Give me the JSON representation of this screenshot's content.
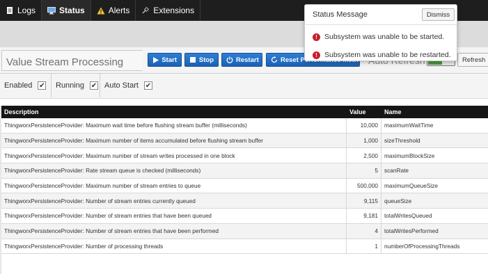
{
  "nav": {
    "tabs": [
      {
        "label": "Logs",
        "icon": "document-icon"
      },
      {
        "label": "Status",
        "icon": "monitor-icon",
        "active": true
      },
      {
        "label": "Alerts",
        "icon": "warning-icon"
      },
      {
        "label": "Extensions",
        "icon": "plug-icon"
      }
    ]
  },
  "panel": {
    "title": "Value Stream Processing",
    "buttons": {
      "start": "Start",
      "stop": "Stop",
      "restart": "Restart",
      "reset": "Reset Performance Metrics"
    },
    "auto_refresh_label": "Auto Refresh",
    "refresh_label": "Refresh"
  },
  "checks": [
    {
      "label": "Enabled",
      "checked": true
    },
    {
      "label": "Running",
      "checked": true
    },
    {
      "label": "Auto Start",
      "checked": true
    }
  ],
  "table": {
    "headers": [
      "Description",
      "Value",
      "Name"
    ],
    "rows": [
      {
        "description": "ThingworxPersistenceProvider: Maximum wait time before flushing stream buffer (milliseconds)",
        "value": "10,000",
        "name": "maximumWaitTime"
      },
      {
        "description": "ThingworxPersistenceProvider: Maximum number of items accumulated before flushing stream buffer",
        "value": "1,000",
        "name": "sizeThreshold"
      },
      {
        "description": "ThingworxPersistenceProvider: Maximum number of stream writes processed in one block",
        "value": "2,500",
        "name": "maximumBlockSize"
      },
      {
        "description": "ThingworxPersistenceProvider: Rate stream queue is checked (milliseconds)",
        "value": "5",
        "name": "scanRate"
      },
      {
        "description": "ThingworxPersistenceProvider: Maximum number of stream entries to queue",
        "value": "500,000",
        "name": "maximumQueueSize"
      },
      {
        "description": "ThingworxPersistenceProvider: Number of stream entries currently queued",
        "value": "9,115",
        "name": "queueSize"
      },
      {
        "description": "ThingworxPersistenceProvider: Number of stream entries that have been queued",
        "value": "9,181",
        "name": "totalWritesQueued"
      },
      {
        "description": "ThingworxPersistenceProvider: Number of stream entries that have been performed",
        "value": "4",
        "name": "totalWritesPerformed"
      },
      {
        "description": "ThingworxPersistenceProvider: Number of processing threads",
        "value": "1",
        "name": "numberOfProcessingThreads"
      }
    ]
  },
  "popup": {
    "title": "Status Message",
    "dismiss_label": "Dismiss",
    "messages": [
      "Subsystem was unable to be started.",
      "Subsystem was unable to be restarted."
    ]
  },
  "colors": {
    "button_blue": "#1b61b3",
    "error_red": "#c8202a",
    "toggle_green": "#4b9a3a",
    "nav_bg": "#1e1e1e"
  }
}
